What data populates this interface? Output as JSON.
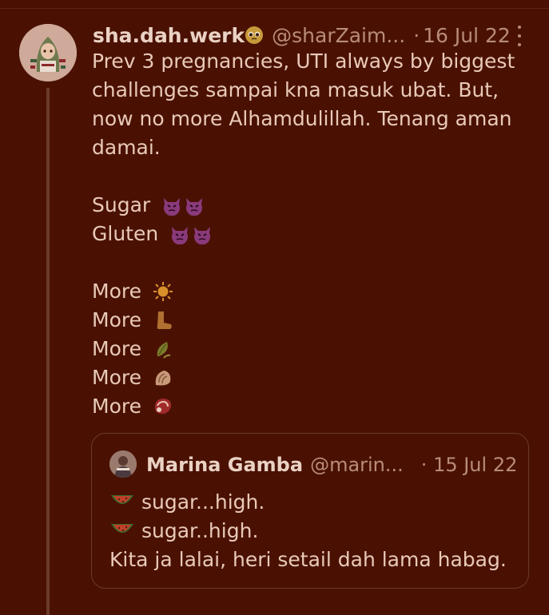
{
  "post": {
    "display_name": "sha.dah.werk",
    "name_emoji": "pleading-face-emoji",
    "handle": "@sharZaim...",
    "separator": "·",
    "date": "16 Jul 22",
    "lines": [
      "Prev 3 pregnancies, UTI always by biggest",
      "challenges sampai kna masuk ubat. But,",
      "now no more Alhamdulillah. Tenang aman",
      "damai."
    ],
    "items": [
      {
        "label": "Sugar",
        "emoji": "angry-devil-emoji x2"
      },
      {
        "label": "Gluten",
        "emoji": "angry-devil-emoji x2"
      }
    ],
    "more_items": [
      {
        "label": "More",
        "emoji": "sun-emoji"
      },
      {
        "label": "More",
        "emoji": "foot-emoji"
      },
      {
        "label": "More",
        "emoji": "leaf-emoji"
      },
      {
        "label": "More",
        "emoji": "spiral-shell-emoji"
      },
      {
        "label": "More",
        "emoji": "cut-of-meat-emoji"
      }
    ]
  },
  "quote": {
    "display_name": "Marina Gamba",
    "handle": "@marin...",
    "separator": "·",
    "date": "15 Jul 22",
    "lines": [
      {
        "text": "sugar...high.",
        "emoji": "watermelon-emoji"
      },
      {
        "text": "sugar..high.",
        "emoji": "watermelon-emoji"
      },
      {
        "text": "Kita ja lalai, heri setail dah lama habag.",
        "emoji": ""
      }
    ]
  },
  "colors": {
    "background": "#4a1103",
    "text": "#e9c9b8",
    "muted": "#b88c79",
    "border": "#6b3a28"
  }
}
